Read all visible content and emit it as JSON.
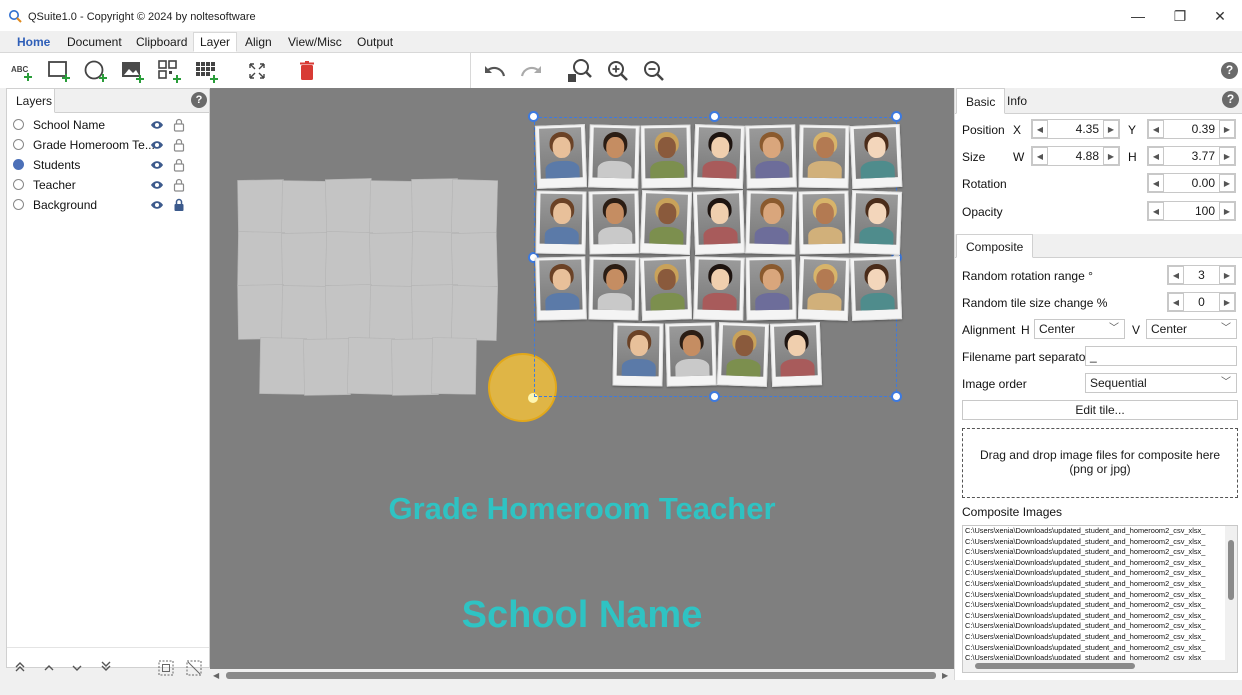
{
  "window": {
    "title": "QSuite1.0 - Copyright © 2024 by noltesoftware",
    "minimize": "—",
    "maximize": "❐",
    "close": "✕"
  },
  "menu": {
    "tabs": [
      "Home",
      "Document",
      "Clipboard",
      "Layer",
      "Align",
      "View/Misc",
      "Output"
    ],
    "active": "Layer"
  },
  "toolbar": {
    "icons": [
      "add-text-icon",
      "add-rectangle-icon",
      "add-ellipse-icon",
      "add-image-icon",
      "add-qr-code-icon",
      "add-composite-icon",
      "fit-icon",
      "delete-icon",
      "undo-icon",
      "redo-icon",
      "zoom-fit-icon",
      "zoom-in-icon",
      "zoom-out-icon",
      "help-icon"
    ],
    "text_icon_label": "ABC",
    "help": "?"
  },
  "layers": {
    "tab_label": "Layers",
    "help": "?",
    "items": [
      {
        "name": "School Name",
        "selected": false,
        "locked": false
      },
      {
        "name": "Grade Homeroom Te...",
        "selected": false,
        "locked": false
      },
      {
        "name": "Students",
        "selected": true,
        "locked": false
      },
      {
        "name": "Teacher",
        "selected": false,
        "locked": false
      },
      {
        "name": "Background",
        "selected": false,
        "locked": true
      }
    ],
    "footer_icons": [
      "move-top-icon",
      "move-up-icon",
      "move-down-icon",
      "move-bottom-icon",
      "select-all-icon",
      "deselect-icon"
    ]
  },
  "canvas": {
    "grade_text": "Grade Homeroom Teacher",
    "school_text": "School Name",
    "background_color": "#7f7f7f",
    "teal": "#2fc3c3",
    "handle_color": "#3d7ae0"
  },
  "props": {
    "tabs": [
      "Basic",
      "Info"
    ],
    "active_tab": "Basic",
    "help": "?",
    "position": {
      "label": "Position",
      "x_label": "X",
      "x": "4.35",
      "y_label": "Y",
      "y": "0.39"
    },
    "size": {
      "label": "Size",
      "w_label": "W",
      "w": "4.88",
      "h_label": "H",
      "h": "3.77"
    },
    "rotation": {
      "label": "Rotation",
      "value": "0.00"
    },
    "opacity": {
      "label": "Opacity",
      "value": "100"
    }
  },
  "composite": {
    "tab": "Composite",
    "random_rotation_label": "Random rotation range °",
    "random_rotation": "3",
    "random_size_label": "Random tile size change %",
    "random_size": "0",
    "alignment_label": "Alignment",
    "h_label": "H",
    "h_value": "Center",
    "v_label": "V",
    "v_value": "Center",
    "separator_label": "Filename part separator",
    "separator_value": "_",
    "order_label": "Image order",
    "order_value": "Sequential",
    "edit_tile": "Edit tile...",
    "drop_text": "Drag and drop image files for composite here (png or jpg)",
    "images_label": "Composite Images",
    "files": [
      "C:\\Users\\xenia\\Downloads\\updated_student_and_homeroom2_csv_xlsx_",
      "C:\\Users\\xenia\\Downloads\\updated_student_and_homeroom2_csv_xlsx_",
      "C:\\Users\\xenia\\Downloads\\updated_student_and_homeroom2_csv_xlsx_",
      "C:\\Users\\xenia\\Downloads\\updated_student_and_homeroom2_csv_xlsx_",
      "C:\\Users\\xenia\\Downloads\\updated_student_and_homeroom2_csv_xlsx_",
      "C:\\Users\\xenia\\Downloads\\updated_student_and_homeroom2_csv_xlsx_",
      "C:\\Users\\xenia\\Downloads\\updated_student_and_homeroom2_csv_xlsx_",
      "C:\\Users\\xenia\\Downloads\\updated_student_and_homeroom2_csv_xlsx_",
      "C:\\Users\\xenia\\Downloads\\updated_student_and_homeroom2_csv_xlsx_",
      "C:\\Users\\xenia\\Downloads\\updated_student_and_homeroom2_csv_xlsx_",
      "C:\\Users\\xenia\\Downloads\\updated_student_and_homeroom2_csv_xlsx_",
      "C:\\Users\\xenia\\Downloads\\updated_student_and_homeroom2_csv_xlsx_",
      "C:\\Users\\xenia\\Downloads\\updated_student_and_homeroom2_csv_xlsx_"
    ]
  }
}
